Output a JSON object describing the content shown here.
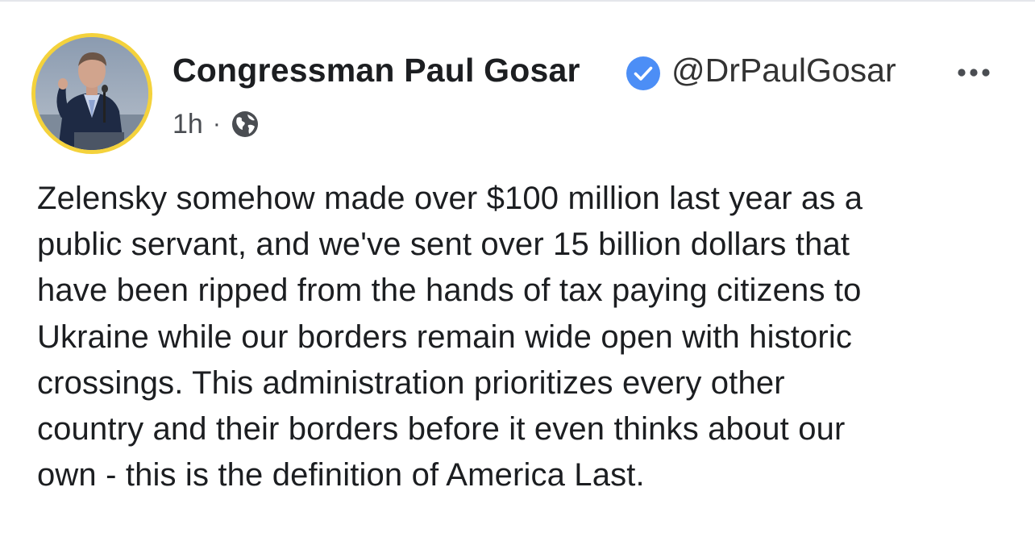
{
  "post": {
    "author": {
      "name": "Congressman Paul Gosar",
      "handle": "@DrPaulGosar",
      "verified": true,
      "avatar_icon": "profile-photo-speaker-at-podium",
      "avatar_ring_color": "#f4d23c"
    },
    "meta": {
      "time": "1h",
      "separator": "·",
      "audience_icon": "globe-icon"
    },
    "more_icon": "ellipsis-icon",
    "verified_color": "#4c8ef6",
    "text_lines": [
      "Zelensky somehow made over $100 million last year as a",
      "public servant, and we've sent over 15 billion dollars that",
      "have been ripped from the hands of tax paying citizens to",
      "Ukraine while our borders remain wide open with historic",
      "crossings. This administration prioritizes every other",
      "country and their borders before it even thinks about our",
      "own - this is the definition of America Last."
    ]
  }
}
